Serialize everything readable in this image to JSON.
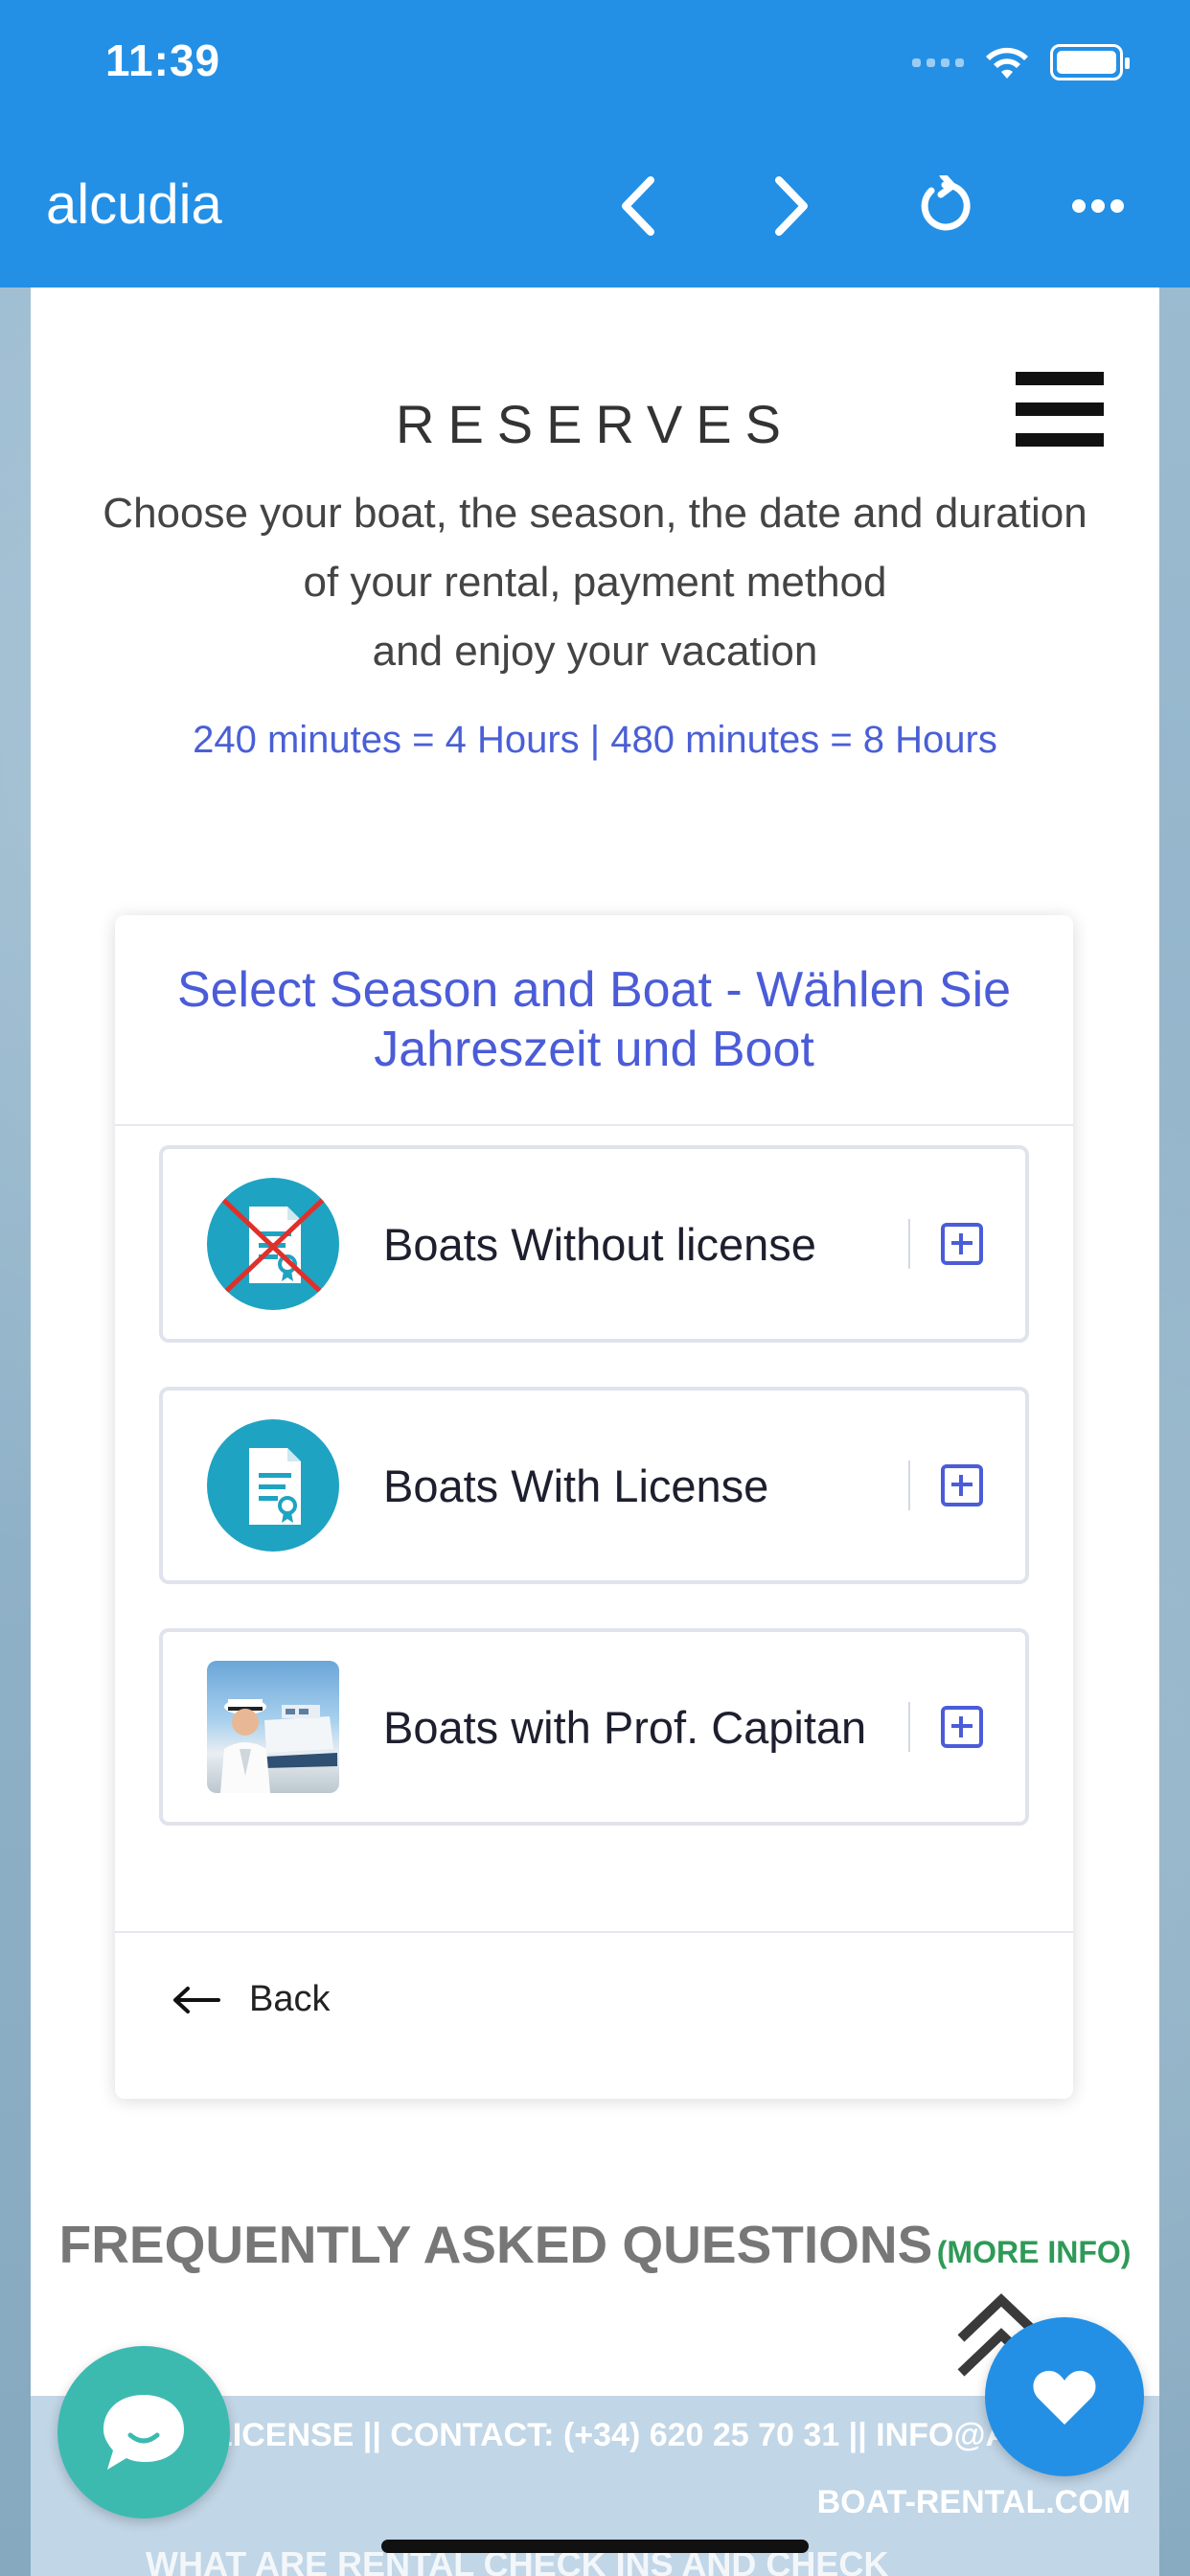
{
  "status_bar": {
    "time": "11:39"
  },
  "nav": {
    "title": "alcudia",
    "back_icon": "chevron-left-icon",
    "forward_icon": "chevron-right-icon",
    "reload_icon": "reload-icon",
    "more_icon": "more-icon"
  },
  "page": {
    "title": "RESERVES",
    "intro_line1": "Choose your boat, the season, the date and duration",
    "intro_line2": "of your rental, payment method",
    "intro_line3": "and enjoy your vacation",
    "minutes_note": "240 minutes = 4 Hours | 480 minutes = 8 Hours"
  },
  "card": {
    "heading": "Select Season and Boat - Wählen Sie Jahreszeit und Boot",
    "options": [
      {
        "label": "Boats Without license",
        "icon": "no-license-icon"
      },
      {
        "label": "Boats With License",
        "icon": "license-icon"
      },
      {
        "label": "Boats with Prof. Capitan",
        "icon": "captain-photo"
      }
    ],
    "back_label": "Back"
  },
  "faq": {
    "title": "FREQUENTLY ASKED QUESTIONS",
    "more": "(MORE INFO)"
  },
  "footer": {
    "line1": "LICENSE || CONTACT: (+34) 620 25 70 31 || INFO@A",
    "line2": "BOAT-RENTAL.COM",
    "line3": "WHAT ARE RENTAL CHECK INS AND CHECK"
  },
  "colors": {
    "accent_blue": "#2390e6",
    "link_blue": "#4b5cd8",
    "teal": "#3dbab0",
    "green": "#2e9a57"
  }
}
